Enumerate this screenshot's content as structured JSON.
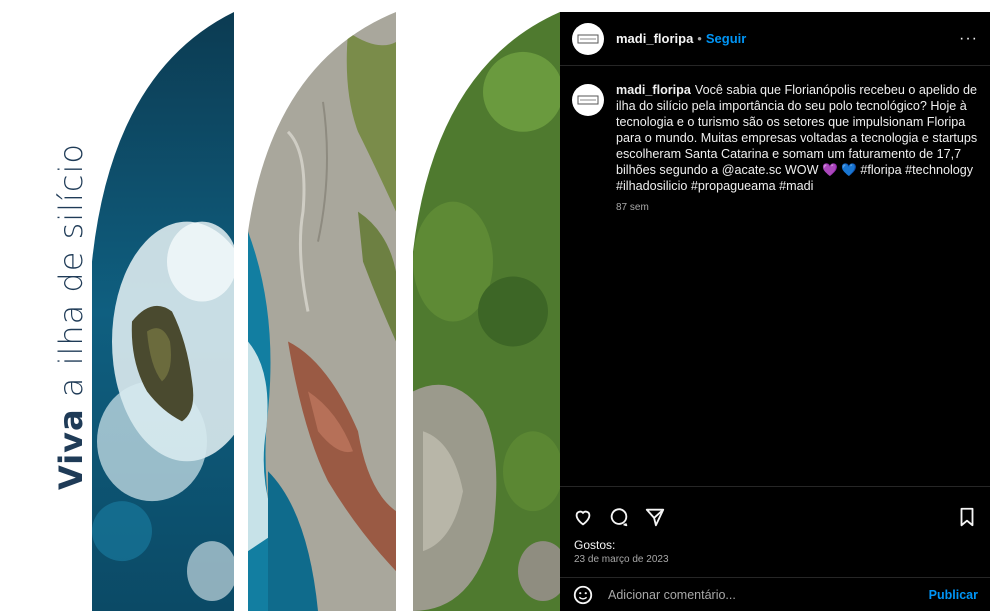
{
  "media": {
    "vertical_title_bold": "Viva",
    "vertical_title_thin": "a ilha de silício"
  },
  "post": {
    "username": "madi_floripa",
    "dot": "•",
    "follow_label": "Seguir",
    "more_label": "···",
    "caption": {
      "username": "madi_floripa",
      "text": "Você sabia que Florianópolis recebeu o apelido de ilha do silício pela importância do seu polo tecnológico? Hoje à tecnologia e o turismo são os setores que impulsionam Floripa para o mundo. Muitas empresas voltadas a tecnologia e startups escolheram Santa Catarina e somam um faturamento de 17,7 bilhões segundo a @acate.sc WOW",
      "heart_purple": "💜",
      "heart_blue": "💙",
      "hashtags": "#floripa #technology #ilhadosilicio #propagueama #madi",
      "time": "87 sem"
    },
    "likes_label": "Gostos:",
    "date": "23 de março de 2023",
    "comment_placeholder": "Adicionar comentário...",
    "publish_label": "Publicar"
  },
  "colors": {
    "background": "#000000",
    "accent": "#0095f6",
    "title_text": "#1f3b57"
  }
}
